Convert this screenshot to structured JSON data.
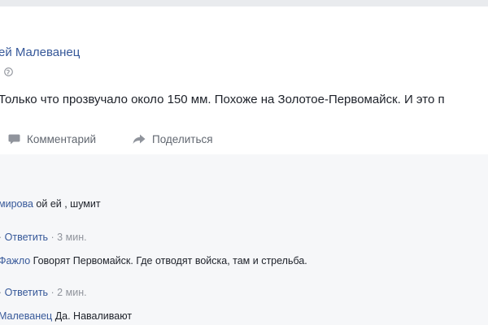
{
  "post": {
    "author": "ей Малеванец",
    "text": "Только что прозвучало около 150 мм. Похоже на Золотое-Первомайск. И это п"
  },
  "actions": {
    "comment_label": "Комментарий",
    "share_label": "Поделиться"
  },
  "comments": [
    {
      "author": "мирова",
      "text": " ой ей , шумит",
      "meta_prefix": "· ",
      "reply_label": "Ответить",
      "time": " · 3 мин."
    },
    {
      "author": "Фажло",
      "text": " Говорят Первомайск. Где отводят войска, там и стрельба.",
      "meta_prefix": "· ",
      "reply_label": "Ответить",
      "time": " · 2 мин."
    },
    {
      "author": "Малеванец",
      "text": " Да. Наваливают"
    }
  ],
  "icons": {
    "privacy": "globe-icon",
    "comment": "comment-icon",
    "share": "share-arrow-icon"
  },
  "colors": {
    "link": "#365899",
    "meta": "#90949c",
    "background": "#e9ebee"
  }
}
